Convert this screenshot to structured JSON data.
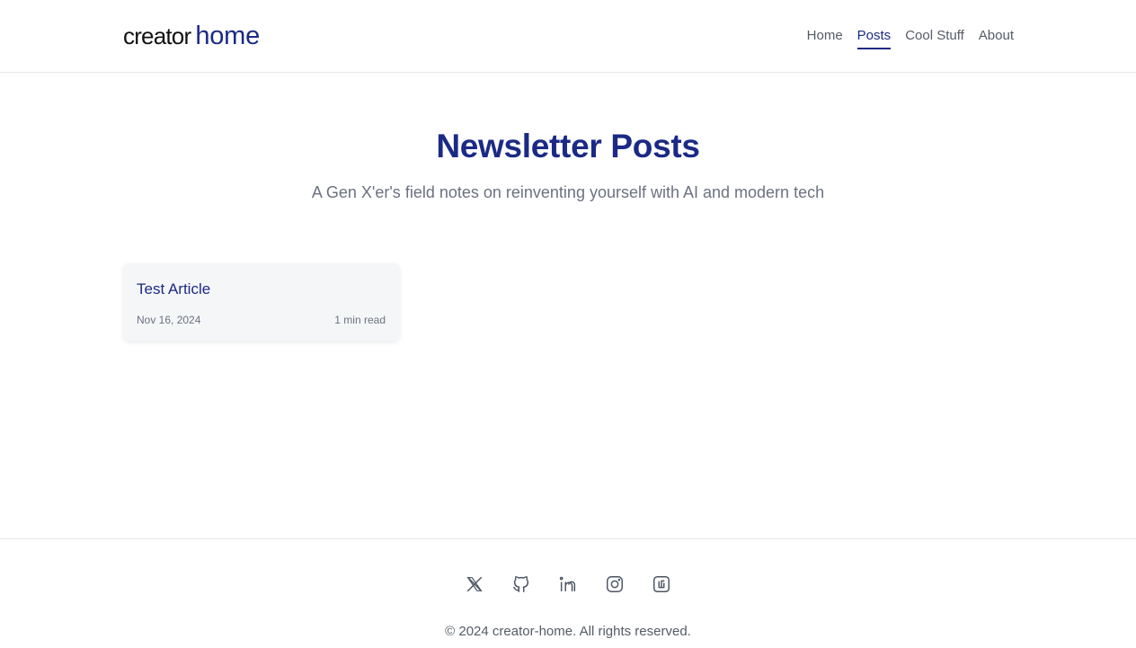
{
  "header": {
    "logo_part1": "creator",
    "logo_part2": "home",
    "nav": [
      {
        "label": "Home",
        "active": false
      },
      {
        "label": "Posts",
        "active": true
      },
      {
        "label": "Cool Stuff",
        "active": false
      },
      {
        "label": "About",
        "active": false
      }
    ]
  },
  "hero": {
    "title": "Newsletter Posts",
    "subtitle": "A Gen X'er's field notes on reinventing yourself with AI and modern tech"
  },
  "posts": [
    {
      "title": "Test Article",
      "date": "Nov 16, 2024",
      "read_time": "1 min read"
    }
  ],
  "footer": {
    "socials": [
      "x-icon",
      "github-icon",
      "linkedin-icon",
      "instagram-icon",
      "substack-icon"
    ],
    "copyright": "© 2024 creator-home. All rights reserved."
  },
  "colors": {
    "brand": "#1b2a85",
    "muted_text": "#6b7280",
    "card_bg": "#f5f6f8",
    "border": "#e5e7eb"
  }
}
